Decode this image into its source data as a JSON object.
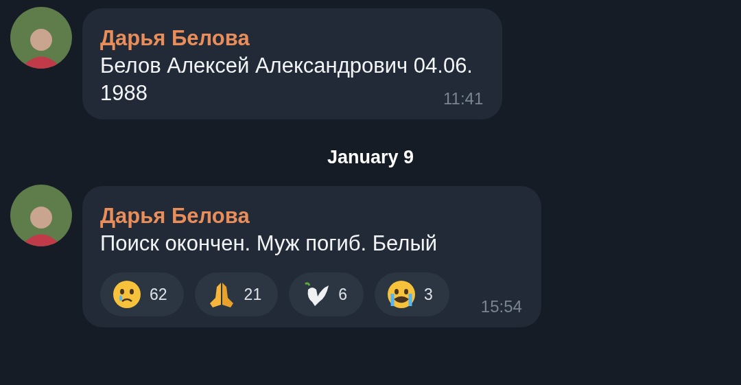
{
  "messages": [
    {
      "sender": "Дарья Белова",
      "lines": [
        "Белов Алексей Александрович 04.06.",
        "1988"
      ],
      "time": "11:41"
    },
    {
      "date": "January 9"
    },
    {
      "sender": "Дарья Белова",
      "lines": [
        "Поиск окончен. Муж погиб. Белый"
      ],
      "time": "15:54",
      "reactions": [
        {
          "kind": "sad",
          "count": "62"
        },
        {
          "kind": "pray",
          "count": "21"
        },
        {
          "kind": "dove",
          "count": "6"
        },
        {
          "kind": "sob",
          "count": "3"
        }
      ]
    }
  ]
}
